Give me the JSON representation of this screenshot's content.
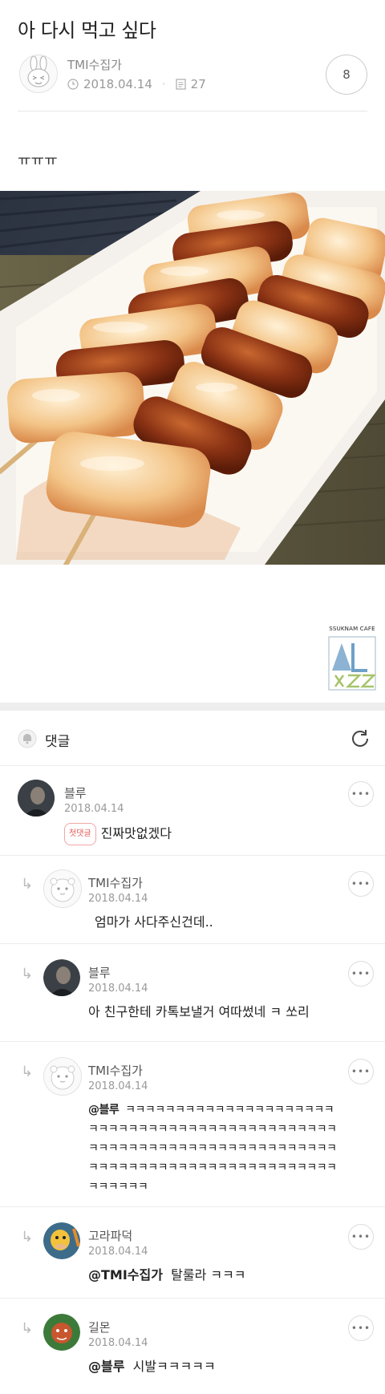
{
  "post": {
    "title": "아 다시 먹고 싶다",
    "author": "TMI수집가",
    "date": "2018.04.14",
    "views": "27",
    "comment_count": "8",
    "body": "ㅠㅠㅠ"
  },
  "watermark": {
    "text": "SSUKNAM CAFE"
  },
  "comments_section": {
    "label": "댓글"
  },
  "comments": [
    {
      "author": "블루",
      "date": "2018.04.14",
      "badge": "첫댓글",
      "text": "진짜맛없겠다"
    },
    {
      "author": "TMI수집가",
      "date": "2018.04.14",
      "text": "엄마가 사다주신건데.."
    },
    {
      "author": "블루",
      "date": "2018.04.14",
      "text": "아 친구한테 카톡보낼거 여따썼네 ㅋ 쏘리"
    },
    {
      "author": "TMI수집가",
      "date": "2018.04.14",
      "mention": "@블루",
      "text_line1": "ㅋㅋㅋㅋㅋㅋㅋㅋㅋㅋㅋㅋㅋㅋㅋㅋㅋㅋㅋㅋㅋ",
      "text_line2": "ㅋㅋㅋㅋㅋㅋㅋㅋㅋㅋㅋㅋㅋㅋㅋㅋㅋㅋㅋㅋㅋㅋㅋㅋㅋ",
      "text_line3": "ㅋㅋㅋㅋㅋㅋㅋㅋㅋㅋㅋㅋㅋㅋㅋㅋㅋㅋㅋㅋㅋㅋㅋㅋㅋ",
      "text_line4": "ㅋㅋㅋㅋㅋㅋㅋㅋㅋㅋㅋㅋㅋㅋㅋㅋㅋㅋㅋㅋㅋㅋㅋㅋㅋ",
      "text_line5": "ㅋㅋㅋㅋㅋㅋ"
    },
    {
      "author": "고라파덕",
      "date": "2018.04.14",
      "mention": "@TMI수집가",
      "text": "탈룰라 ㅋㅋㅋ"
    },
    {
      "author": "길몬",
      "date": "2018.04.14",
      "mention": "@블루",
      "text": "시발ㅋㅋㅋㅋㅋ"
    }
  ],
  "more_label": "•••",
  "reply_arrow": "↳",
  "colors": {
    "accent_badge": "#e35a5a",
    "divider": "#ececec"
  }
}
